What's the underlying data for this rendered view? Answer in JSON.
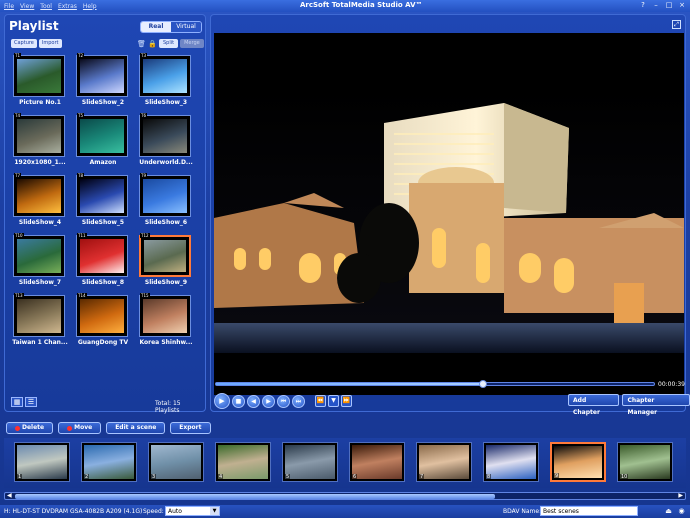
{
  "menu": [
    "File",
    "View",
    "Tool",
    "Extras",
    "Help"
  ],
  "app_title": "ArcSoft TotalMedia Studio AV™",
  "window_controls": [
    "?",
    "–",
    "□",
    "×"
  ],
  "playlist": {
    "title": "Playlist",
    "toggle": [
      "Real",
      "Virtual"
    ],
    "capture_label": "Capture",
    "import_label": "Import",
    "split_label": "Split",
    "merge_label": "Merge",
    "total": "Total: 15 Playlists",
    "items": [
      {
        "label": "Picture No.1",
        "tag": "T1",
        "colors": [
          "#6fa0d8",
          "#2a5a2a",
          "#3a7a3a"
        ]
      },
      {
        "label": "SlideShow_2",
        "tag": "T2",
        "colors": [
          "#0a0a1a",
          "#5a7acb",
          "#cfd8ff"
        ]
      },
      {
        "label": "SlideShow_3",
        "tag": "T3",
        "colors": [
          "#1a3a7a",
          "#4aa0e8",
          "#aee4ff"
        ]
      },
      {
        "label": "1920x1080_1...",
        "tag": "T4",
        "colors": [
          "#2a3a3a",
          "#6a6a5a",
          "#aab0a0"
        ]
      },
      {
        "label": "Amazon",
        "tag": "T5",
        "colors": [
          "#0a4a4a",
          "#1a8a7a",
          "#3ac0a0"
        ]
      },
      {
        "label": "Underworld.D...",
        "tag": "T6",
        "colors": [
          "#0a0a0a",
          "#3a4a5a",
          "#8a8a7a"
        ]
      },
      {
        "label": "SlideShow_4",
        "tag": "T7",
        "colors": [
          "#1a0a00",
          "#c06a10",
          "#ffc040"
        ]
      },
      {
        "label": "SlideShow_5",
        "tag": "T8",
        "colors": [
          "#000010",
          "#2a4ab0",
          "#cfe0ff"
        ]
      },
      {
        "label": "SlideShow_6",
        "tag": "T9",
        "colors": [
          "#1a4aa0",
          "#3a7ae0",
          "#8ac0ff"
        ]
      },
      {
        "label": "SlideShow_7",
        "tag": "T10",
        "colors": [
          "#3a7aa0",
          "#2a6a3a",
          "#7ab05a"
        ]
      },
      {
        "label": "SlideShow_8",
        "tag": "T11",
        "colors": [
          "#a01010",
          "#e03030",
          "#fff0f0"
        ]
      },
      {
        "label": "SlideShow_9",
        "tag": "T12",
        "colors": [
          "#8a9aa0",
          "#5a6a50",
          "#c0b080"
        ]
      },
      {
        "label": "Taiwan 1 Chan...",
        "tag": "T13",
        "colors": [
          "#3a3020",
          "#8a7a5a",
          "#d0b890"
        ]
      },
      {
        "label": "GuangDong TV",
        "tag": "T14",
        "colors": [
          "#5a2a00",
          "#d06a10",
          "#ffb040"
        ]
      },
      {
        "label": "Korea Shinhw...",
        "tag": "T15",
        "colors": [
          "#5a3a2a",
          "#c08060",
          "#f0d0b0"
        ]
      }
    ],
    "selected_index": 11
  },
  "player": {
    "time": "00:00:39",
    "progress": 0.61,
    "add_chapter": "Add Chapter",
    "chapter_manager": "Chapter Manager",
    "transport": [
      "▶",
      "■",
      "◀",
      "▶",
      "⏮",
      "⏭"
    ],
    "nav": [
      "⏪",
      "▼",
      "⏩"
    ]
  },
  "scenes": {
    "toolbar": {
      "delete": "Delete",
      "move": "Move",
      "edit": "Edit a scene",
      "export": "Export"
    },
    "selected_index": 8,
    "items": [
      {
        "num": "1",
        "colors": [
          "#6a8ab0",
          "#c0c8c0",
          "#2a3a4a"
        ]
      },
      {
        "num": "2",
        "colors": [
          "#2a6ab0",
          "#8ab0e0",
          "#3a5a3a"
        ]
      },
      {
        "num": "3",
        "colors": [
          "#a0b8d0",
          "#7090a8",
          "#506070"
        ]
      },
      {
        "num": "4",
        "colors": [
          "#3a6a2a",
          "#c0b090",
          "#7a9a6a"
        ]
      },
      {
        "num": "5",
        "colors": [
          "#2a3a4a",
          "#8a9aaa",
          "#4a5a6a"
        ]
      },
      {
        "num": "6",
        "colors": [
          "#3a1a0a",
          "#c08060",
          "#6a3a2a"
        ]
      },
      {
        "num": "7",
        "colors": [
          "#8a6a4a",
          "#e0c0a0",
          "#5a4a3a"
        ]
      },
      {
        "num": "8",
        "colors": [
          "#1a2a6a",
          "#e0e0f0",
          "#2a60c0"
        ]
      },
      {
        "num": "9",
        "colors": [
          "#0a0a0a",
          "#e0a060",
          "#ffe0b0"
        ]
      },
      {
        "num": "10",
        "colors": [
          "#3a5a2a",
          "#a0c090",
          "#2a3a20"
        ]
      }
    ]
  },
  "status": {
    "drive": "H: HL-DT-ST DVDRAM GSA-4082B A209  (4.1G)",
    "speed_label": "Speed:",
    "speed_value": "Auto",
    "bdav_label": "BDAV Name:",
    "bdav_value": "Best scenes"
  }
}
